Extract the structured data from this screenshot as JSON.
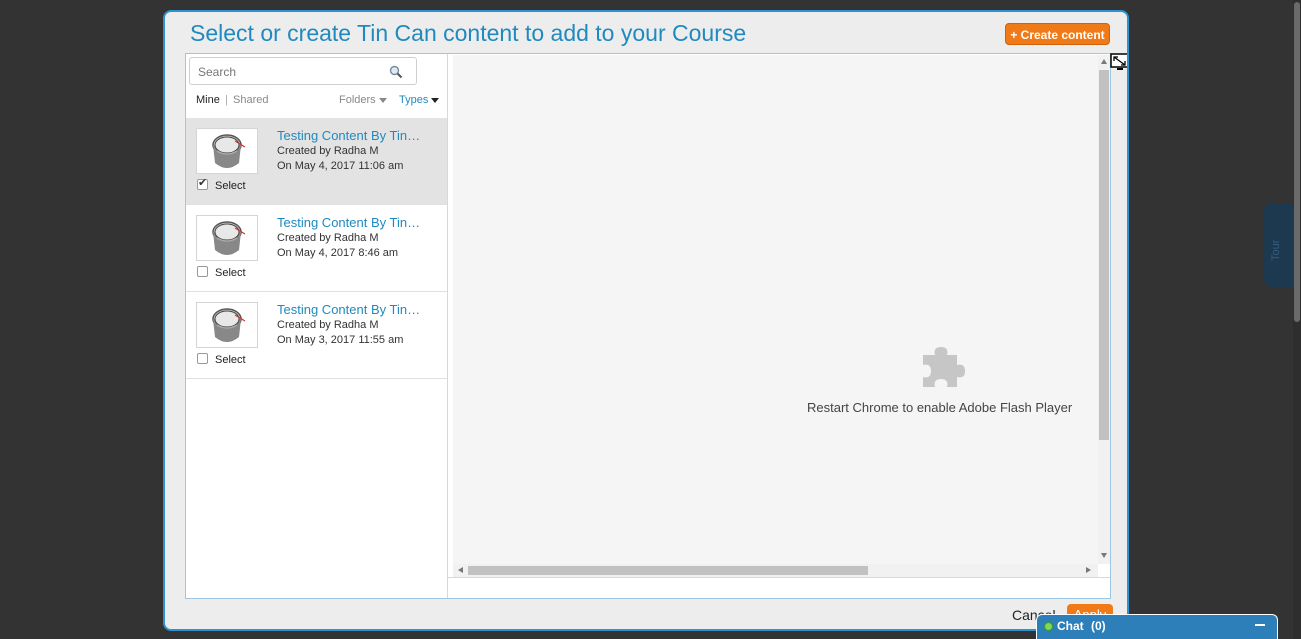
{
  "dialog": {
    "title": "Select or create Tin Can content to add to your Course",
    "create_button": "+ Create content",
    "cancel_label": "Cancel",
    "apply_label": "Apply"
  },
  "search": {
    "placeholder": "Search"
  },
  "filters": {
    "mine": "Mine",
    "separator": "|",
    "shared": "Shared",
    "folders": "Folders",
    "types": "Types"
  },
  "items": [
    {
      "title": "Testing Content By Tin…",
      "author": "Created by Radha M",
      "date": "On May 4, 2017 11:06 am",
      "select_label": "Select",
      "checked": true
    },
    {
      "title": "Testing Content By Tin…",
      "author": "Created by Radha M",
      "date": "On May 4, 2017 8:46 am",
      "select_label": "Select",
      "checked": false
    },
    {
      "title": "Testing Content By Tin…",
      "author": "Created by Radha M",
      "date": "On May 3, 2017 11:55 am",
      "select_label": "Select",
      "checked": false
    }
  ],
  "preview": {
    "message": "Restart Chrome to enable Adobe Flash Player"
  },
  "chat": {
    "label": "Chat",
    "count": "(0)"
  },
  "tour": {
    "label": "Tour"
  },
  "colors": {
    "accent": "#1f8ac0",
    "button": "#f07a17",
    "chat": "#2c7fb8"
  }
}
